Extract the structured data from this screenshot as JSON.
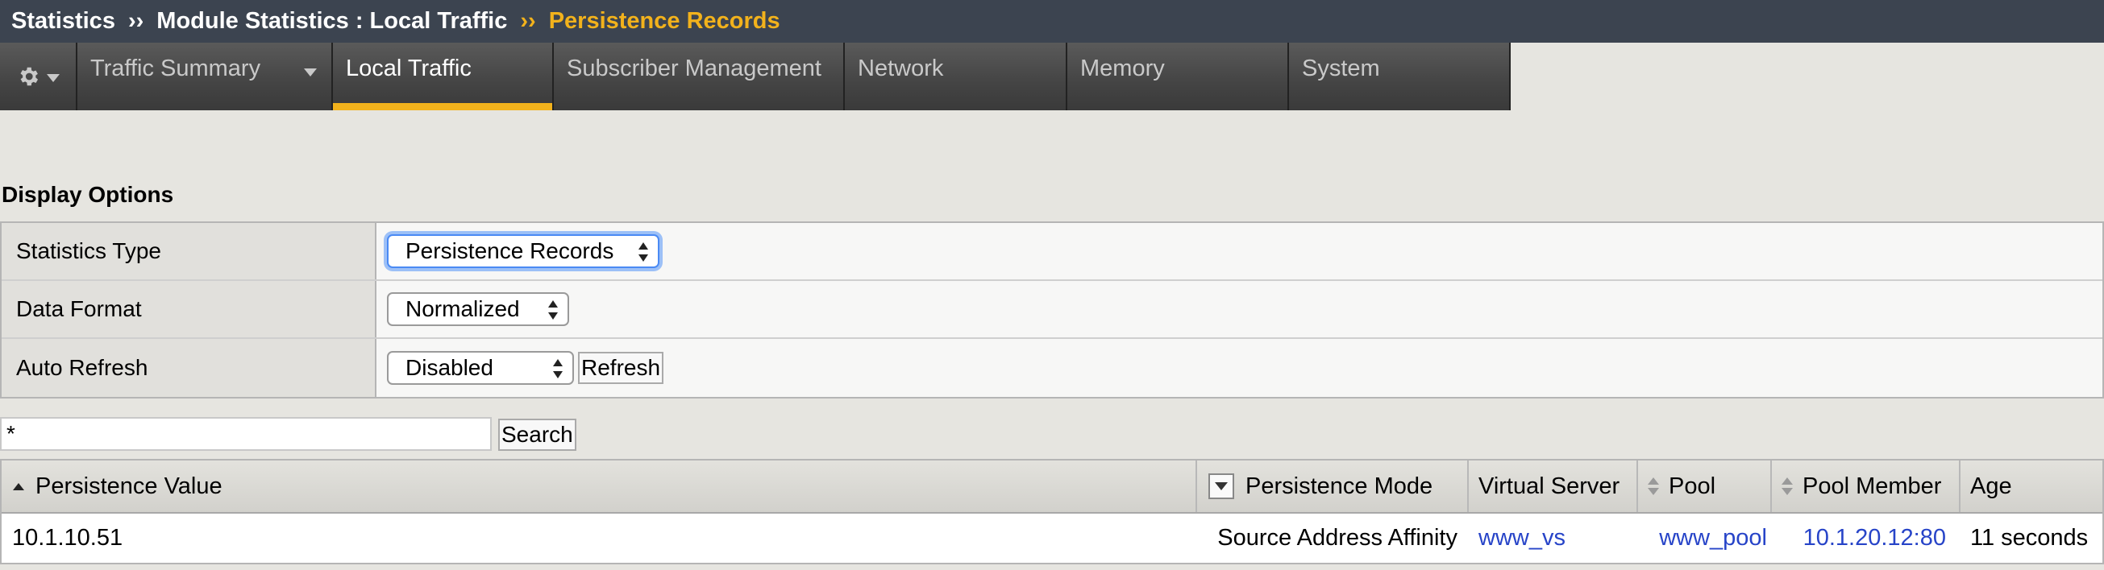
{
  "breadcrumb": {
    "items": [
      "Statistics",
      "Module Statistics : Local Traffic",
      "Persistence Records"
    ],
    "separator": "››"
  },
  "tabs": [
    {
      "label": "Traffic Summary",
      "has_dropdown": true
    },
    {
      "label": "Local Traffic",
      "active": true
    },
    {
      "label": "Subscriber Management"
    },
    {
      "label": "Network"
    },
    {
      "label": "Memory"
    },
    {
      "label": "System"
    }
  ],
  "display_options": {
    "title": "Display Options",
    "rows": [
      {
        "label": "Statistics Type",
        "value": "Persistence Records"
      },
      {
        "label": "Data Format",
        "value": "Normalized"
      },
      {
        "label": "Auto Refresh",
        "value": "Disabled",
        "button": "Refresh"
      }
    ]
  },
  "search": {
    "value": "*",
    "button": "Search"
  },
  "table": {
    "headers": [
      "Persistence Value",
      "Persistence Mode",
      "Virtual Server",
      "Pool",
      "Pool Member",
      "Age"
    ],
    "rows": [
      {
        "persistence_value": "10.1.10.51",
        "persistence_mode": "Source Address Affinity",
        "virtual_server": "www_vs",
        "pool": "www_pool",
        "pool_member": "10.1.20.12:80",
        "age": "11 seconds"
      }
    ]
  },
  "colors": {
    "header_bg": "#3c4450",
    "accent": "#f2b21c",
    "link": "#2744c8",
    "page_bg": "#e6e5e0"
  },
  "icons": {
    "settings": "gear-icon"
  }
}
